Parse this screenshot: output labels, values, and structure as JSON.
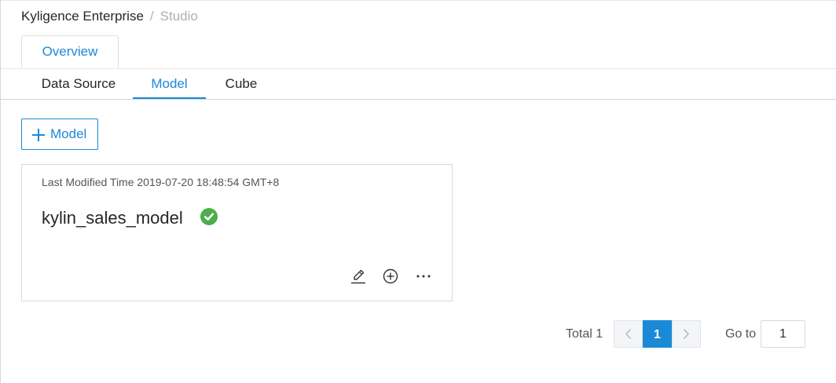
{
  "breadcrumb": {
    "root": "Kyligence Enterprise",
    "separator": "/",
    "current": "Studio"
  },
  "tabs": {
    "overview": "Overview"
  },
  "subtabs": [
    {
      "label": "Data Source",
      "active": false
    },
    {
      "label": "Model",
      "active": true
    },
    {
      "label": "Cube",
      "active": false
    }
  ],
  "toolbar": {
    "add_model_label": "Model",
    "add_icon": "plus-icon"
  },
  "model_card": {
    "modified_label": "Last Modified Time 2019-07-20 18:48:54 GMT+8",
    "name": "kylin_sales_model",
    "status": "healthy",
    "status_icon": "check-circle-icon",
    "status_color": "#4cae4c",
    "actions": [
      "edit-icon",
      "add-circle-icon",
      "more-icon"
    ]
  },
  "pagination": {
    "total_label": "Total 1",
    "current_page": "1",
    "goto_label": "Go to",
    "goto_value": "1"
  },
  "colors": {
    "accent": "#1a8ad6"
  }
}
